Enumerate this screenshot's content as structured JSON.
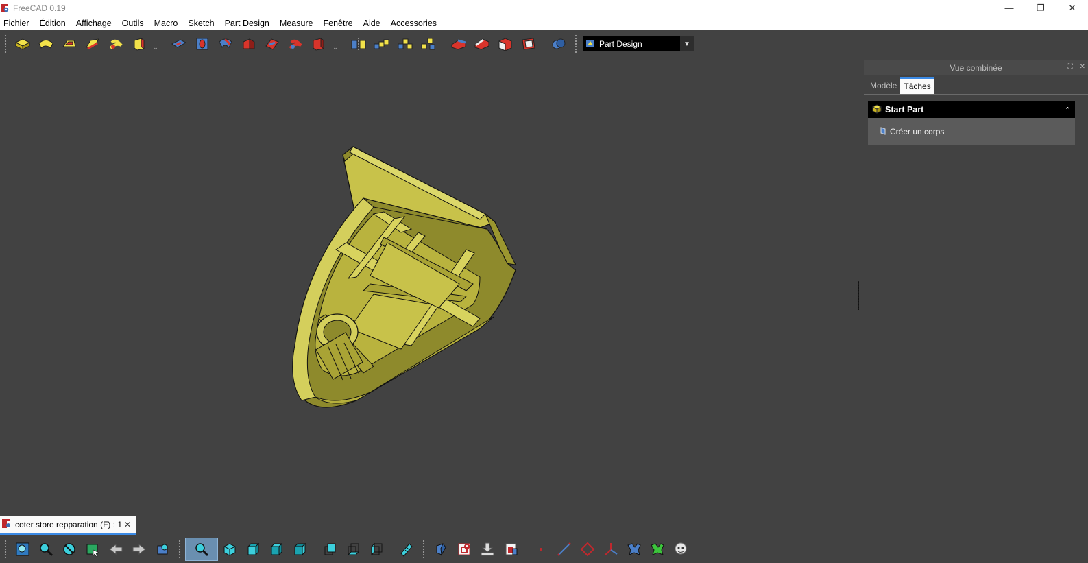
{
  "window": {
    "title": "FreeCAD 0.19",
    "minimize_glyph": "—",
    "restore_glyph": "❐",
    "close_glyph": "✕"
  },
  "menubar": {
    "items": [
      "Fichier",
      "Édition",
      "Affichage",
      "Outils",
      "Macro",
      "Sketch",
      "Part Design",
      "Measure",
      "Fenêtre",
      "Aide",
      "Accessories"
    ]
  },
  "toolbar": {
    "workbench_selected": "Part Design",
    "dropdown_glyph": "⌄",
    "icons": [
      "pad-icon",
      "revolution-icon",
      "additive-loft-icon",
      "additive-pipe-icon",
      "additive-helix-icon",
      "additive-primitive-icon",
      "pocket-icon",
      "hole-icon",
      "groove-icon",
      "subtractive-loft-icon",
      "subtractive-pipe-icon",
      "subtractive-helix-icon",
      "subtractive-primitive-icon",
      "mirrored-icon",
      "linear-pattern-icon",
      "polar-pattern-icon",
      "multitransform-icon",
      "fillet-icon",
      "chamfer-icon",
      "draft-icon",
      "thickness-icon",
      "boolean-icon"
    ]
  },
  "combo_view": {
    "title": "Vue combinée",
    "tabs": [
      "Modèle",
      "Tâches"
    ],
    "active_tab": "Tâches",
    "task_panel": {
      "title": "Start Part",
      "collapse_glyph": "⌃",
      "action": "Créer un corps"
    }
  },
  "document_tab": {
    "label": "coter store repparation (F) : 1",
    "close_glyph": "✕"
  },
  "bottom_toolbar": {
    "icons": [
      "fit-all-icon",
      "fit-selection-icon",
      "draw-style-icon",
      "selection-filter-icon",
      "back-icon",
      "forward-icon",
      "workbench-icon",
      "std-zoom-icon",
      "isometric-view-icon",
      "front-view-icon",
      "top-view-icon",
      "right-view-icon",
      "rear-view-icon",
      "bottom-view-icon",
      "left-view-icon",
      "measure-distance-icon",
      "create-body-icon",
      "create-sketch-icon",
      "import-icon",
      "shape-binder-icon",
      "datum-point-icon",
      "datum-line-icon",
      "datum-plane-icon",
      "local-cs-icon",
      "clone-icon",
      "sub-shape-binder-icon",
      "addon-icon"
    ]
  },
  "colors": {
    "model_face": "#c8c24a",
    "model_dark": "#8e8a2c",
    "model_light": "#dcd86a",
    "background": "#424242",
    "accent": "#3b8ae5"
  }
}
